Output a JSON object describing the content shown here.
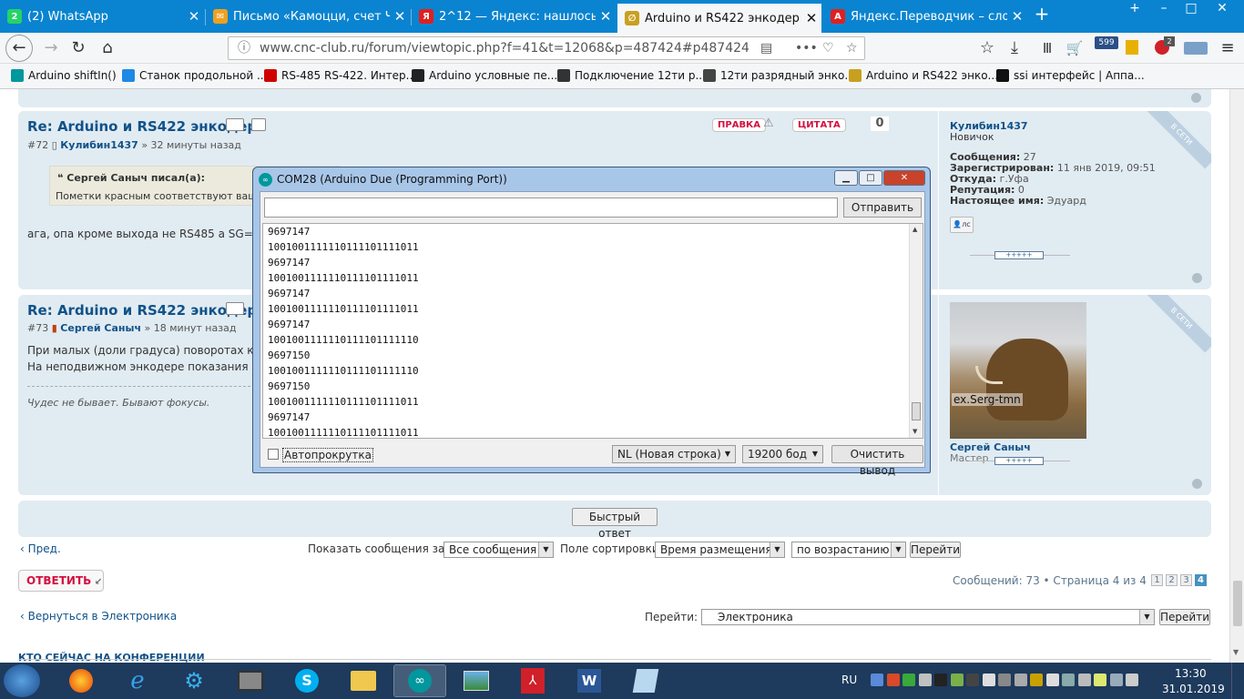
{
  "tabs": [
    {
      "label": "(2) WhatsApp",
      "color": "#25d366",
      "glyph": "2",
      "active": false
    },
    {
      "label": "Письмо «Камоцци, счет ЧЛ Н",
      "color": "#f0a020",
      "glyph": "✉",
      "active": false
    },
    {
      "label": "2^12 — Яндекс: нашлось 72 м",
      "color": "#e02020",
      "glyph": "Я",
      "active": false
    },
    {
      "label": "Arduino и RS422 энкодер • Ста",
      "color": "#c8a020",
      "glyph": "∅",
      "active": true
    },
    {
      "label": "Яндекс.Переводчик – словарь",
      "color": "#e02020",
      "glyph": "A",
      "active": false
    }
  ],
  "nav": {
    "url": "www.cnc-club.ru/forum/viewtopic.php?f=41&t=12068&p=487424#p487424",
    "downloads_badge": "599",
    "addon_badge": "2"
  },
  "bookmarks": [
    {
      "label": "Arduino shiftIn()",
      "color": "#00979d"
    },
    {
      "label": "Станок продольной ...",
      "color": "#1e88e5"
    },
    {
      "label": "RS-485 RS-422. Интер...",
      "color": "#d00000"
    },
    {
      "label": "Arduino условные пе...",
      "color": "#222222"
    },
    {
      "label": "Подключение 12ти р...",
      "color": "#333333"
    },
    {
      "label": "12ти разрядный энко...",
      "color": "#444444"
    },
    {
      "label": "Arduino и RS422 энко...",
      "color": "#c8a020"
    },
    {
      "label": "ssi интерфейс | Аппа...",
      "color": "#111111"
    }
  ],
  "post72": {
    "title": "Re: Arduino и RS422 энкодер",
    "num": "#72",
    "author": "Кулибин1437",
    "time": "» 32 минуты назад",
    "edit": "ПРАВКА",
    "quote": "ЦИТАТА",
    "score": "0",
    "quote_author": "Сергей Саныч писал(а):",
    "quote_text": "Пометки красным соответствуют ваше",
    "body": "ага, опа кроме выхода не RS485 а SG=SS",
    "user": {
      "name": "Кулибин1437",
      "rank": "Новичок",
      "online": "В СЕТИ",
      "rows": [
        [
          "Сообщения:",
          "27"
        ],
        [
          "Зарегистрирован:",
          "11 янв 2019, 09:51"
        ],
        [
          "Откуда:",
          "г.Уфа"
        ],
        [
          "Репутация:",
          "0"
        ],
        [
          "Настоящее имя:",
          "Эдуард"
        ]
      ],
      "pm": "лс",
      "stars": "+++++"
    }
  },
  "post73": {
    "title": "Re: Arduino и RS422 энкодер",
    "num": "#73",
    "author": "Сергей Саныч",
    "time": "» 18 минут назад",
    "line1": "При малых (доли градуса) поворотах как",
    "line2": "На неподвижном энкодере показания ст",
    "signature": "Чудес не бывает. Бывают фокусы.",
    "user": {
      "name": "Сергей Саныч",
      "rank": "Мастер",
      "online": "В СЕТИ",
      "avatar_caption": "ex.Serg-tmn",
      "stars": "+++++"
    }
  },
  "serial": {
    "title": "COM28 (Arduino Due (Programming Port))",
    "send": "Отправить",
    "lines": [
      "9697147",
      "1001001111110111101111011",
      "9697147",
      "1001001111110111101111011",
      "9697147",
      "1001001111110111101111011",
      "9697147",
      "1001001111110111101111110",
      "9697150",
      "1001001111110111101111110",
      "9697150",
      "1001001111110111101111011",
      "9697147",
      "1001001111110111101111011"
    ],
    "autoscroll": "Автопрокрутка",
    "line_ending": "NL (Новая строка)",
    "baud": "19200 бод",
    "clear": "Очистить вывод"
  },
  "quick_reply": "Быстрый ответ",
  "controls": {
    "prev": "Пред.",
    "show_label": "Показать сообщения за:",
    "show_value": "Все сообщения",
    "sort_label": "Поле сортировки",
    "sort_value": "Время размещения",
    "order_value": "по возрастанию",
    "go": "Перейти",
    "reply": "ОТВЕТИТЬ",
    "pagination": "Сообщений: 73 • Страница 4 из 4 •",
    "pages": [
      "1",
      "2",
      "3",
      "4"
    ],
    "back": "Вернуться в Электроника",
    "jump_label": "Перейти:",
    "jump_value": "Электроника",
    "jump_go": "Перейти",
    "who": "КТО СЕЙЧАС НА КОНФЕРЕНЦИИ"
  },
  "taskbar": {
    "lang": "RU",
    "time": "13:30",
    "date": "31.01.2019"
  }
}
